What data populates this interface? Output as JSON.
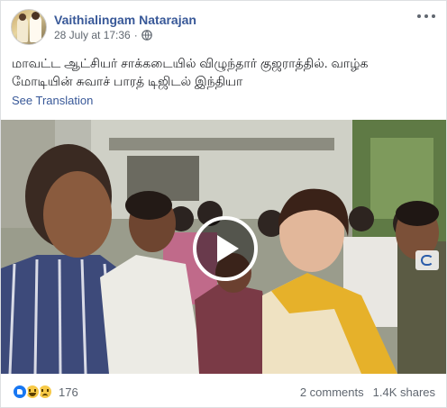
{
  "post": {
    "author": "Vaithialingam Natarajan",
    "timestamp": "28 July at 17:36",
    "separator": "·",
    "privacy_icon": "globe-icon",
    "text_line1": "மாவட்ட ஆட்சியர் சாக்கடையில் விழுந்தார் குஜராத்தில். வாழ்க",
    "text_line2": "மோடியின் சுவாச் பாரத் டிஜிடல் இந்தியா",
    "see_translation": "See Translation",
    "video": {
      "play_icon": "play-icon",
      "watermark_icon": "channel-logo-icon"
    },
    "footer": {
      "reaction_icons": [
        "like-icon",
        "haha-icon",
        "sad-icon"
      ],
      "reaction_count": "176",
      "comments": "2 comments",
      "shares": "1.4K shares"
    }
  },
  "colors": {
    "link": "#385898",
    "secondary_text": "#606770",
    "like_blue": "#1877f2",
    "emoji_yellow": "#f7c947"
  }
}
